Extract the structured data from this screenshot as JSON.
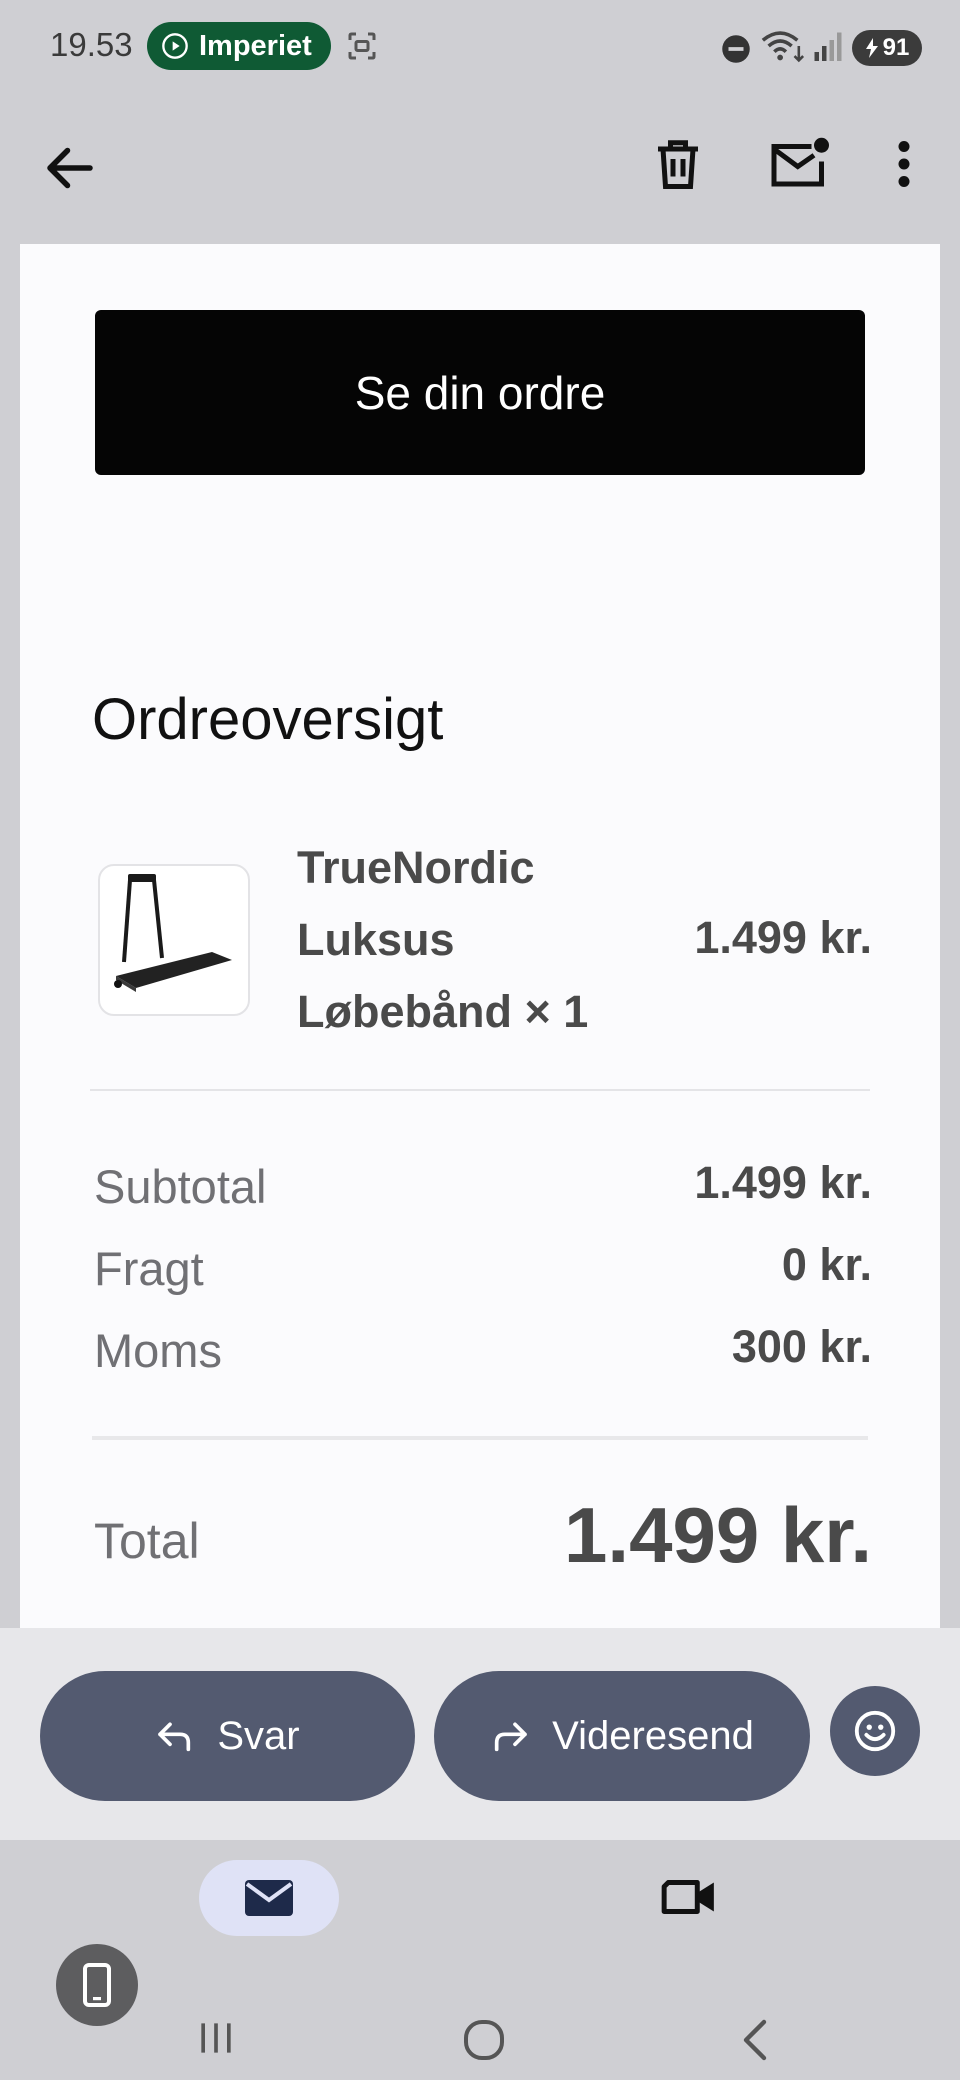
{
  "status_bar": {
    "time": "19.53",
    "pill_label": "Imperiet",
    "battery_level": "91",
    "icons": [
      "screenshot-icon",
      "do-not-disturb-icon",
      "wifi-icon",
      "signal-icon",
      "battery-icon"
    ]
  },
  "toolbar": {
    "icons": [
      "back-arrow-icon",
      "trash-icon",
      "mark-unread-icon",
      "more-vert-icon"
    ]
  },
  "email": {
    "cta_label": "Se din ordre",
    "section_title": "Ordreoversigt",
    "product": {
      "name": "TrueNordic Luksus Løbebånd × 1",
      "price": "1.499 kr.",
      "image_icon": "treadmill-image"
    },
    "summary": [
      {
        "label": "Subtotal",
        "value": "1.499 kr."
      },
      {
        "label": "Fragt",
        "value": "0 kr."
      },
      {
        "label": "Moms",
        "value": "300 kr."
      }
    ],
    "total_label": "Total",
    "total_value": "1.499 kr."
  },
  "actions": {
    "reply_label": "Svar",
    "forward_label": "Videresend",
    "emoji_icon": "emoji-icon"
  },
  "bottom_nav": {
    "tabs": [
      "mail-icon",
      "video-icon"
    ],
    "floating_icon": "phone-icon",
    "system_buttons": [
      "recent-apps",
      "home",
      "back"
    ]
  },
  "colors": {
    "action_button": "#535a70",
    "status_pill": "#0f5a34",
    "cta_background": "#050505",
    "content_background": "#fbfbfd"
  }
}
